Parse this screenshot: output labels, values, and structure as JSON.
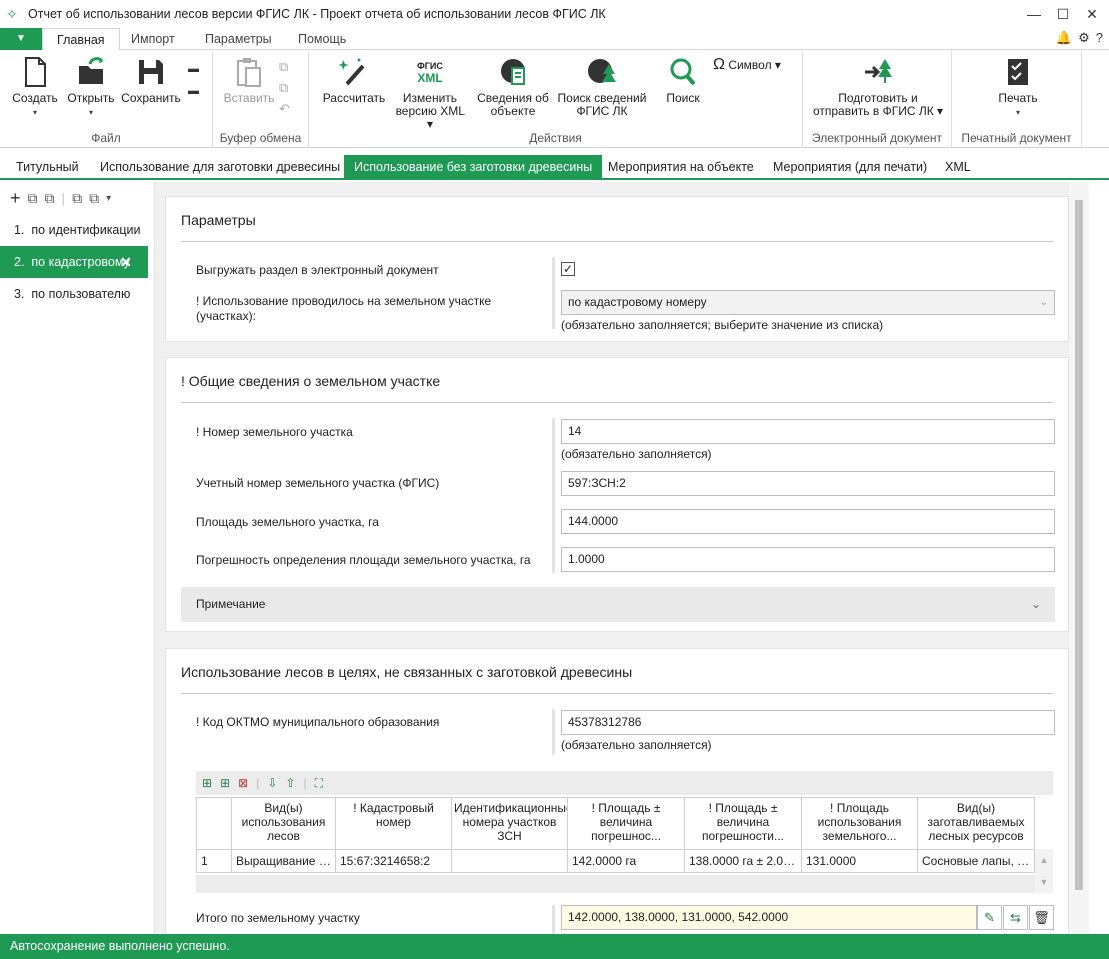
{
  "window": {
    "title": "Отчет об использовании лесов версии ФГИС ЛК - Проект отчета об использовании лесов ФГИС ЛК"
  },
  "ribbon_tabs": [
    "Главная",
    "Импорт",
    "Параметры",
    "Помощь"
  ],
  "ribbon": {
    "file": {
      "label": "Файл",
      "create": "Создать",
      "open": "Открыть",
      "save": "Сохранить"
    },
    "clipboard": {
      "label": "Буфер обмена",
      "paste": "Вставить"
    },
    "actions": {
      "label": "Действия",
      "calculate": "Рассчитать",
      "change_xml": "Изменить версию XML",
      "object_info": "Сведения об объекте",
      "search_fgis": "Поиск сведений ФГИС ЛК",
      "search": "Поиск",
      "symbol": "Символ",
      "xml_badge_top": "ФГИС",
      "xml_badge_bottom": "XML"
    },
    "edoc": {
      "label": "Электронный документ",
      "prepare": "Подготовить и отправить в ФГИС ЛК"
    },
    "print": {
      "label": "Печатный документ",
      "print": "Печать"
    }
  },
  "doc_tabs": [
    "Титульный",
    "Использование для заготовки древесины",
    "Использование без заготовки древесины",
    "Мероприятия на объекте",
    "Мероприятия (для печати)",
    "XML"
  ],
  "sidebar": {
    "items": [
      {
        "num": "1.",
        "label": "по идентификации"
      },
      {
        "num": "2.",
        "label": "по кадастровому"
      },
      {
        "num": "3.",
        "label": "по пользователю"
      }
    ]
  },
  "params": {
    "header": "Параметры",
    "export_label": "Выгружать раздел в электронный документ",
    "export_checked": true,
    "usage_label": "! Использование проводилось на земельном участке (участках):",
    "usage_value": "по кадастровому номеру",
    "usage_hint": "(обязательно заполняется; выберите значение из списка)"
  },
  "land": {
    "header": "! Общие сведения о земельном участке",
    "number_label": "! Номер земельного участка",
    "number_value": "14",
    "number_hint": "(обязательно заполняется)",
    "account_label": "Учетный номер земельного участка (ФГИС)",
    "account_value": "597:ЗСН:2",
    "area_label": "Площадь земельного участка, га",
    "area_value": "144.0000",
    "error_label": "Погрешность определения площади земельного участка, га",
    "error_value": "1.0000",
    "note_label": "Примечание"
  },
  "usage": {
    "header": "Использование лесов в целях, не связанных с заготовкой древесины",
    "oktmo_label": "! Код ОКТМО муниципального образования",
    "oktmo_value": "45378312786",
    "oktmo_hint": "(обязательно заполняется)",
    "table": {
      "columns": [
        "Вид(ы) использования лесов",
        "! Кадастровый номер",
        "Идентификационные номера участков ЗСН",
        "! Площадь ± величина погрешнос...",
        "! Площадь ± величина погрешности...",
        "! Площадь использования земельного...",
        "Вид(ы) заготавливаемых лесных ресурсов"
      ],
      "rows": [
        {
          "num": "1",
          "cells": [
            "Выращивание л...",
            "15:67:3214658:2",
            "",
            "142.0000 га",
            "138.0000 га ± 2.00...",
            "131.0000",
            "Сосновые лапы, 5..."
          ]
        }
      ]
    },
    "total_label": "Итого по земельному участку",
    "total_value": "142.0000, 138.0000, 131.0000, 542.0000"
  },
  "status": "Автосохранение выполнено успешно."
}
